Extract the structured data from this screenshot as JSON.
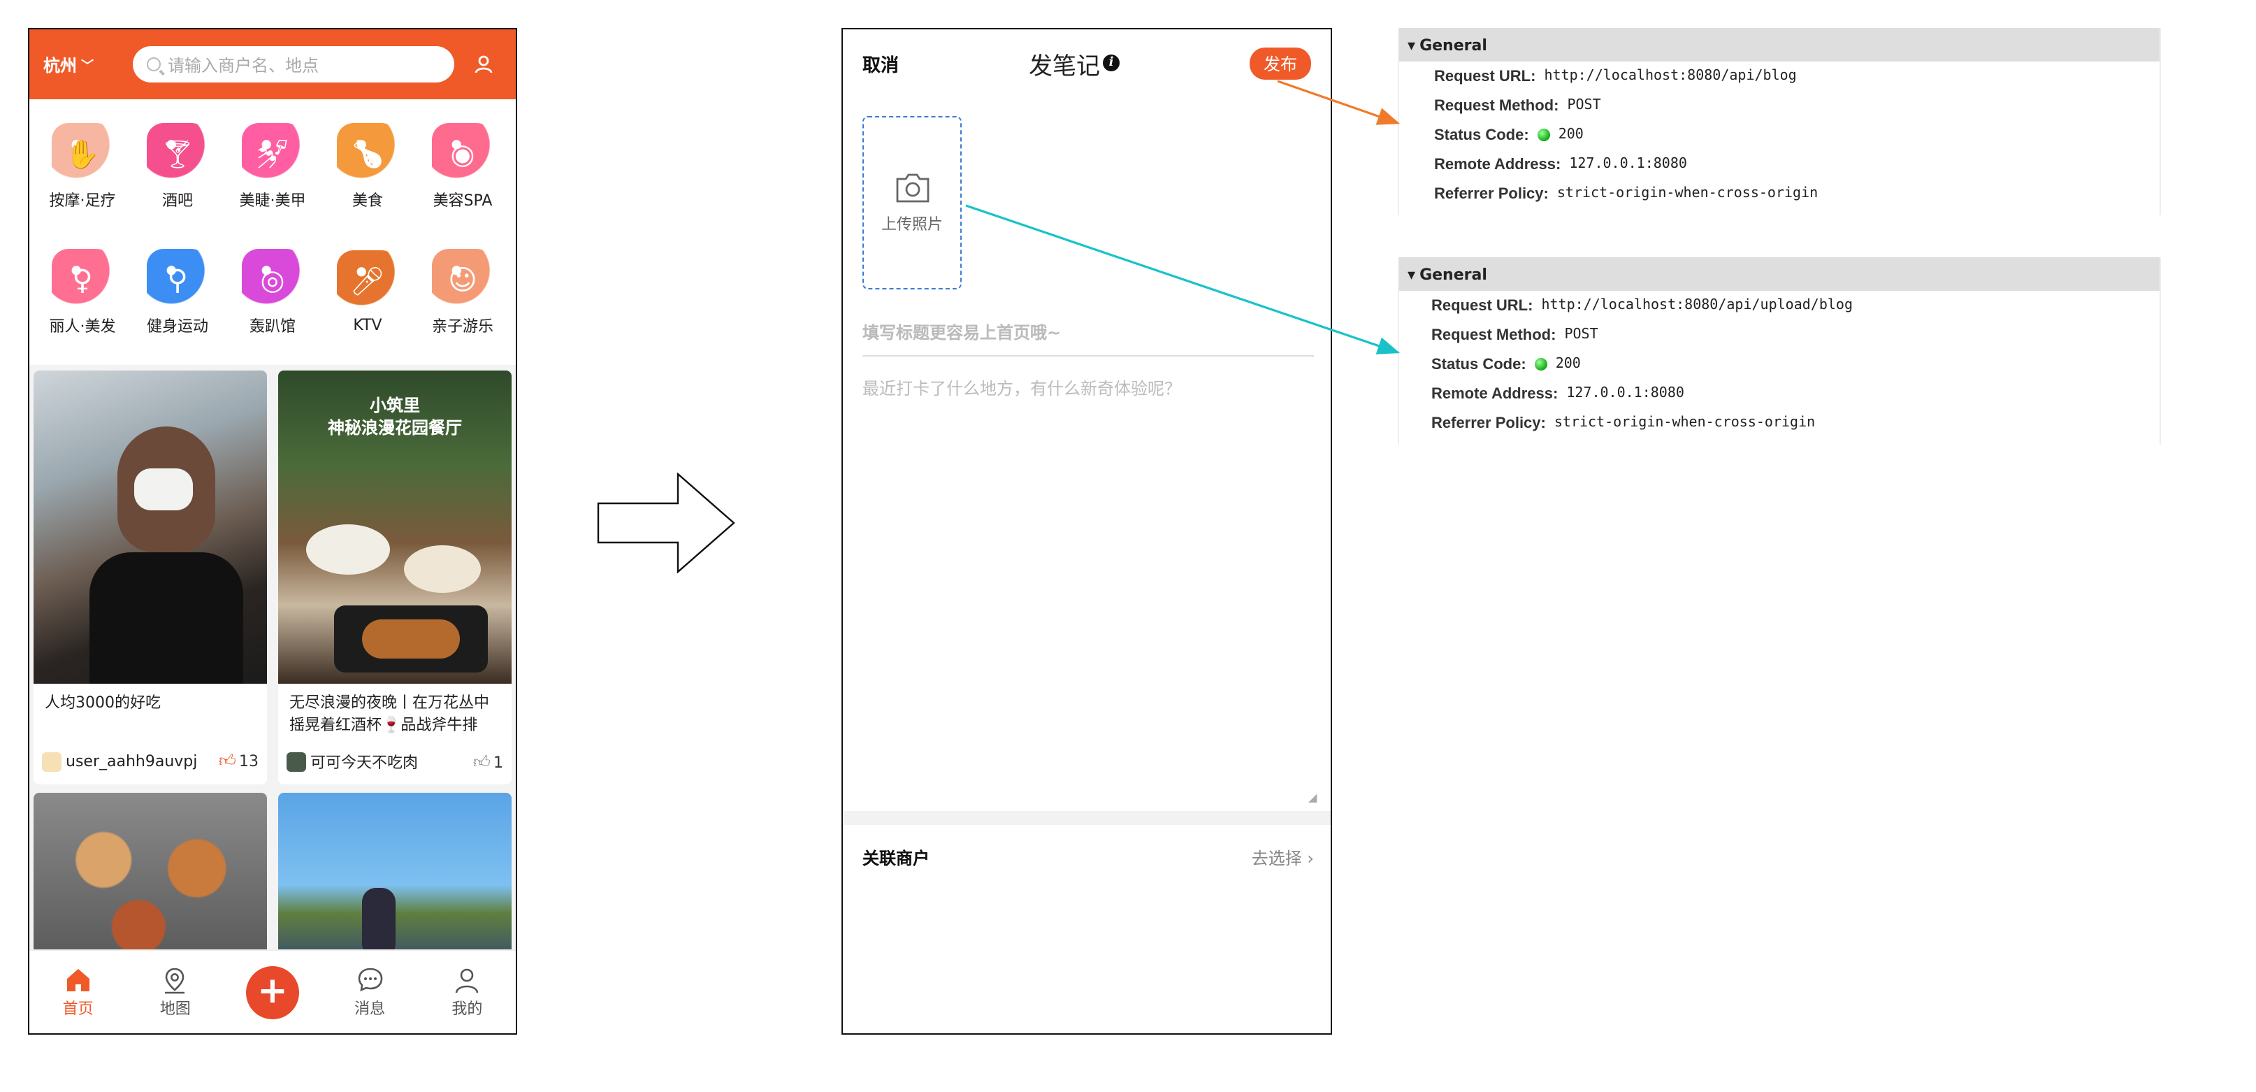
{
  "phone1": {
    "city": "杭州",
    "search_placeholder": "请输入商户名、地点",
    "categories": [
      {
        "label": "按摩·足疗",
        "icon": "massage-hand-icon",
        "color": "#f7b6a2"
      },
      {
        "label": "酒吧",
        "icon": "cocktail-icon",
        "color": "#f5508d"
      },
      {
        "label": "美睫·美甲",
        "icon": "nail-icon",
        "color": "#ff5fa2"
      },
      {
        "label": "美食",
        "icon": "roast-chicken-icon",
        "color": "#f59a3c"
      },
      {
        "label": "美容SPA",
        "icon": "face-mask-icon",
        "color": "#ff6b8f"
      },
      {
        "label": "丽人·美发",
        "icon": "hair-icon",
        "color": "#ff6f91"
      },
      {
        "label": "健身运动",
        "icon": "dumbbell-icon",
        "color": "#3c8ef5"
      },
      {
        "label": "轰趴馆",
        "icon": "party-mask-icon",
        "color": "#d94adb"
      },
      {
        "label": "KTV",
        "icon": "microphone-icon",
        "color": "#e6742e"
      },
      {
        "label": "亲子游乐",
        "icon": "parent-child-icon",
        "color": "#f49b76"
      }
    ],
    "cards": [
      {
        "title": "人均3000的好吃",
        "author": "user_aahh9auvpj",
        "likes": "13",
        "image_caption": ""
      },
      {
        "title": "无尽浪漫的夜晚丨在万花丛中摇晃着红酒杯🍷品战斧牛排",
        "author": "可可今天不吃肉",
        "likes": "1",
        "image_caption_1": "小筑里",
        "image_caption_2": "神秘浪漫花园餐厅"
      },
      {
        "title": "",
        "author": "",
        "likes": ""
      },
      {
        "title": "",
        "author": "",
        "likes": ""
      }
    ],
    "tabs": [
      {
        "label": "首页",
        "icon": "home-icon"
      },
      {
        "label": "地图",
        "icon": "map-pin-icon"
      },
      {
        "label": "+",
        "icon": "plus-icon"
      },
      {
        "label": "消息",
        "icon": "chat-icon"
      },
      {
        "label": "我的",
        "icon": "user-icon"
      }
    ],
    "accent": "#f05a28"
  },
  "phone2": {
    "cancel": "取消",
    "title": "发笔记",
    "publish": "发布",
    "upload_label": "上传照片",
    "title_placeholder": "填写标题更容易上首页哦~",
    "body_placeholder": "最近打卡了什么地方，有什么新奇体验呢？",
    "merchant_label": "关联商户",
    "merchant_action": "去选择"
  },
  "devtools": [
    {
      "header": "General",
      "rows": [
        {
          "key": "Request URL:",
          "value": "http://localhost:8080/api/blog"
        },
        {
          "key": "Request Method:",
          "value": "POST"
        },
        {
          "key": "Status Code:",
          "value": "200",
          "status_dot": true
        },
        {
          "key": "Remote Address:",
          "value": "127.0.0.1:8080"
        },
        {
          "key": "Referrer Policy:",
          "value": "strict-origin-when-cross-origin"
        }
      ]
    },
    {
      "header": "General",
      "rows": [
        {
          "key": "Request URL:",
          "value": "http://localhost:8080/api/upload/blog"
        },
        {
          "key": "Request Method:",
          "value": "POST"
        },
        {
          "key": "Status Code:",
          "value": "200",
          "status_dot": true
        },
        {
          "key": "Remote Address:",
          "value": "127.0.0.1:8080"
        },
        {
          "key": "Referrer Policy:",
          "value": "strict-origin-when-cross-origin"
        }
      ]
    }
  ],
  "arrows": {
    "publish_arrow_color": "#f07a28",
    "upload_arrow_color": "#19c2c9"
  }
}
